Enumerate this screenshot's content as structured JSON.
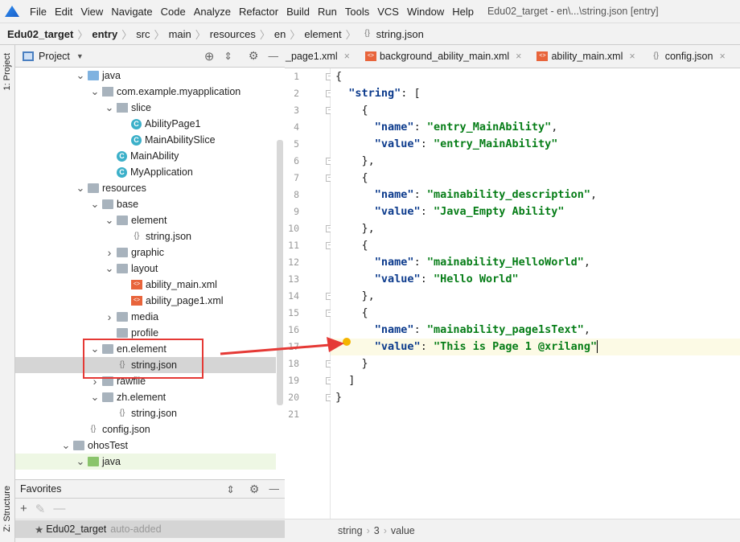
{
  "menubar": {
    "items": [
      "File",
      "Edit",
      "View",
      "Navigate",
      "Code",
      "Analyze",
      "Refactor",
      "Build",
      "Run",
      "Tools",
      "VCS",
      "Window",
      "Help"
    ],
    "window_title": "Edu02_target - en\\...\\string.json [entry]"
  },
  "breadcrumb": [
    "Edu02_target",
    "entry",
    "src",
    "main",
    "resources",
    "en",
    "element",
    "string.json"
  ],
  "side": {
    "project_tab": "1: Project",
    "structure_tab": "Z: Structure"
  },
  "project": {
    "title": "Project"
  },
  "tree": [
    {
      "label": "java",
      "level": 0,
      "type": "folder-blue",
      "expanded": true
    },
    {
      "label": "com.example.myapplication",
      "level": 1,
      "type": "package",
      "expanded": true
    },
    {
      "label": "slice",
      "level": 2,
      "type": "package",
      "expanded": true
    },
    {
      "label": "AbilityPage1",
      "level": 3,
      "type": "class"
    },
    {
      "label": "MainAbilitySlice",
      "level": 3,
      "type": "class"
    },
    {
      "label": "MainAbility",
      "level": 2,
      "type": "class"
    },
    {
      "label": "MyApplication",
      "level": 2,
      "type": "class"
    },
    {
      "label": "resources",
      "level": 0,
      "type": "folder",
      "expanded": true
    },
    {
      "label": "base",
      "level": 1,
      "type": "folder",
      "expanded": true
    },
    {
      "label": "element",
      "level": 2,
      "type": "folder",
      "expanded": true
    },
    {
      "label": "string.json",
      "level": 3,
      "type": "json"
    },
    {
      "label": "graphic",
      "level": 2,
      "type": "folder",
      "expanded": false
    },
    {
      "label": "layout",
      "level": 2,
      "type": "folder",
      "expanded": true
    },
    {
      "label": "ability_main.xml",
      "level": 3,
      "type": "xml"
    },
    {
      "label": "ability_page1.xml",
      "level": 3,
      "type": "xml"
    },
    {
      "label": "media",
      "level": 2,
      "type": "folder",
      "expanded": false
    },
    {
      "label": "profile",
      "level": 2,
      "type": "folder"
    },
    {
      "label": "en.element",
      "level": 1,
      "type": "folder",
      "expanded": true
    },
    {
      "label": "string.json",
      "level": 2,
      "type": "json",
      "selected": true
    },
    {
      "label": "rawfile",
      "level": 1,
      "type": "folder",
      "expanded": false
    },
    {
      "label": "zh.element",
      "level": 1,
      "type": "folder",
      "expanded": true
    },
    {
      "label": "string.json",
      "level": 2,
      "type": "json"
    },
    {
      "label": "config.json",
      "level": 0,
      "type": "json"
    },
    {
      "label": "ohosTest",
      "level": -1,
      "type": "folder",
      "expanded": true
    },
    {
      "label": "java",
      "level": 0,
      "type": "folder-green",
      "expanded": true,
      "highlight": true
    }
  ],
  "favorites": {
    "title": "Favorites",
    "item": "Edu02_target",
    "item_note": "auto-added"
  },
  "tabs": [
    "_page1.xml",
    "background_ability_main.xml",
    "ability_main.xml",
    "config.json"
  ],
  "code": [
    "{",
    "  \"string\": [",
    "    {",
    "      \"name\": \"entry_MainAbility\",",
    "      \"value\": \"entry_MainAbility\"",
    "    },",
    "    {",
    "      \"name\": \"mainability_description\",",
    "      \"value\": \"Java_Empty Ability\"",
    "    },",
    "    {",
    "      \"name\": \"mainability_HelloWorld\",",
    "      \"value\": \"Hello World\"",
    "    },",
    "    {",
    "      \"name\": \"mainability_page1sText\",",
    "      \"value\": \"This is Page 1 @xrilang\"",
    "    }",
    "  ]",
    "}",
    ""
  ],
  "current_line": 17,
  "status": {
    "path": [
      "string",
      "3",
      "value"
    ]
  },
  "colors": {
    "annotation": "#e53935",
    "string": "#067d17",
    "key": "#871094"
  }
}
